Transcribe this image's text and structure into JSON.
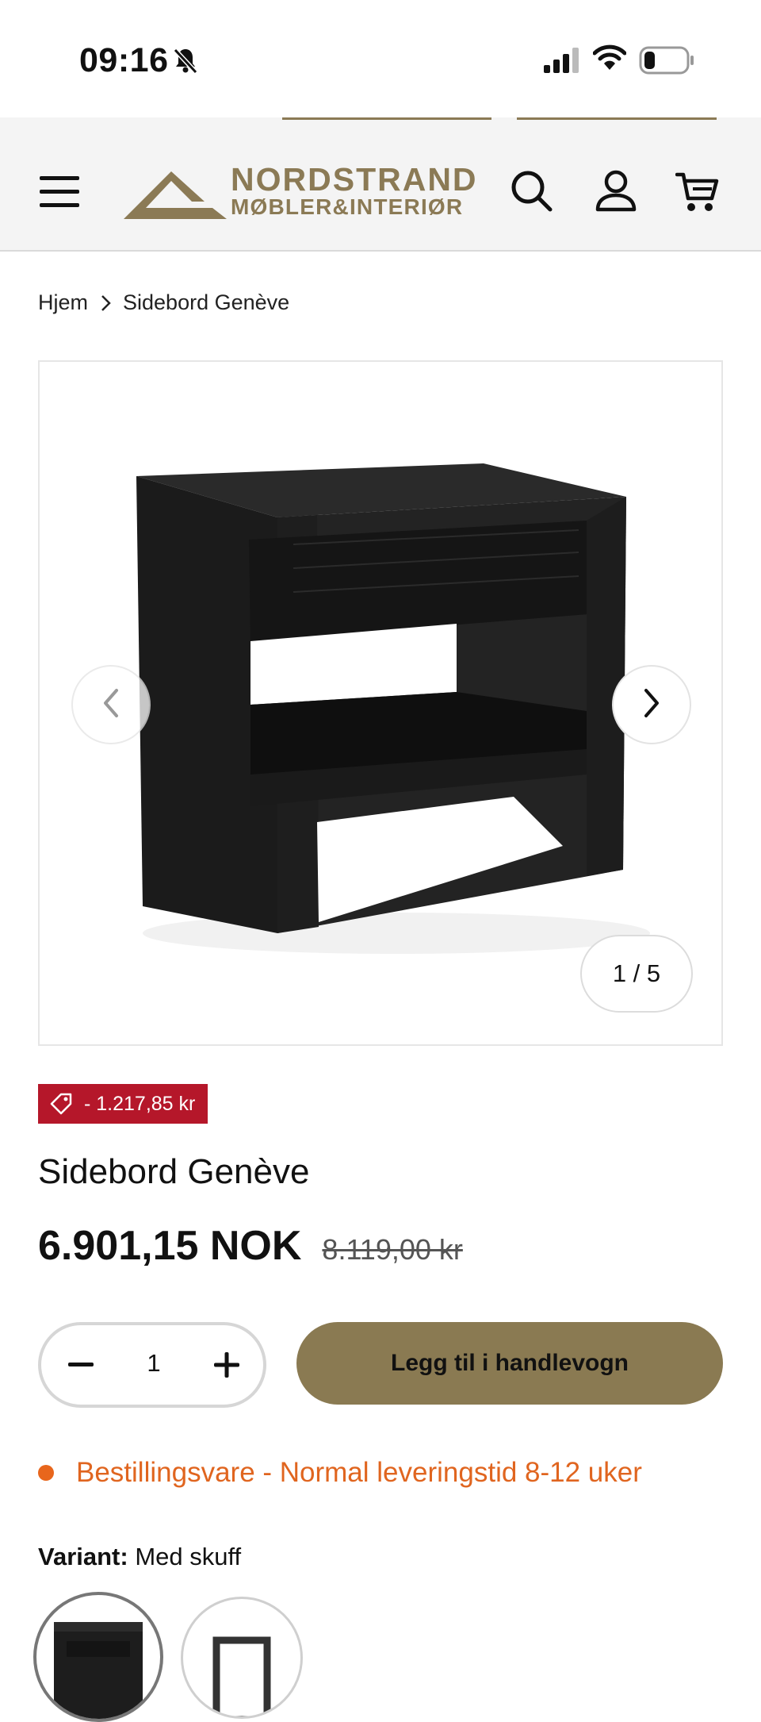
{
  "status_bar": {
    "time": "09:16",
    "icons": [
      "bell-slash-icon",
      "cellular-signal-icon",
      "wifi-icon",
      "battery-icon"
    ]
  },
  "header": {
    "logo": {
      "line1": "NORDSTRAND",
      "line2": "MØBLER&INTERIØR"
    },
    "icons": [
      "menu-icon",
      "search-icon",
      "account-icon",
      "cart-icon"
    ]
  },
  "breadcrumb": {
    "home": "Hjem",
    "current": "Sidebord Genève"
  },
  "gallery": {
    "counter": "1 / 5",
    "image_alt": "Sidebord Genève"
  },
  "product": {
    "discount_badge": "- 1.217,85 kr",
    "title": "Sidebord Genève",
    "price": "6.901,15 NOK",
    "compare_price": "8.119,00 kr"
  },
  "quantity": {
    "value": "1"
  },
  "add_to_cart": {
    "label": "Legg til i handlevogn"
  },
  "stock": {
    "text": "Bestillingsvare - Normal leveringstid 8-12 uker"
  },
  "variant": {
    "label": "Variant:",
    "value": "Med skuff"
  },
  "colors": {
    "brand_gold": "#8a7a52",
    "sale_red": "#b5172a",
    "stock_orange": "#e0651f"
  }
}
